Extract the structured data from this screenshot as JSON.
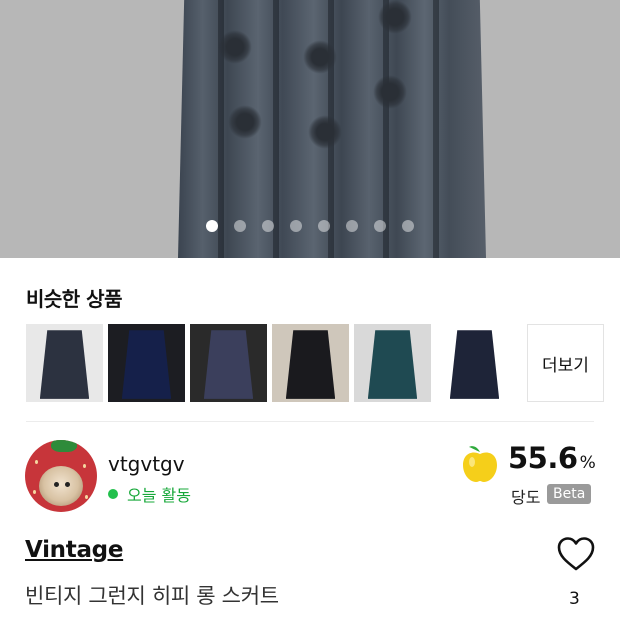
{
  "carousel": {
    "total": 8,
    "active": 0
  },
  "similar": {
    "title": "비슷한 상품",
    "more_label": "더보기",
    "items": [
      {
        "bg": "#e8e8e8",
        "color": "#2c3240"
      },
      {
        "bg": "#1c1d22",
        "color": "#15204a"
      },
      {
        "bg": "#2a2a2a",
        "color": "#3b3f5c"
      },
      {
        "bg": "#cfc7bb",
        "color": "#1a1a1e"
      },
      {
        "bg": "#d9d9d9",
        "color": "#1f4a52"
      },
      {
        "bg": "#ffffff",
        "color": "#1e2438"
      }
    ]
  },
  "seller": {
    "name": "vtgvtgv",
    "activity": "오늘 활동",
    "sweetness_value": "55.6",
    "sweetness_unit": "%",
    "sweetness_label": "당도",
    "beta_badge": "Beta"
  },
  "product": {
    "brand": "Vintage",
    "title": "빈티지 그런지 히피 롱 스커트",
    "likes": "3"
  }
}
